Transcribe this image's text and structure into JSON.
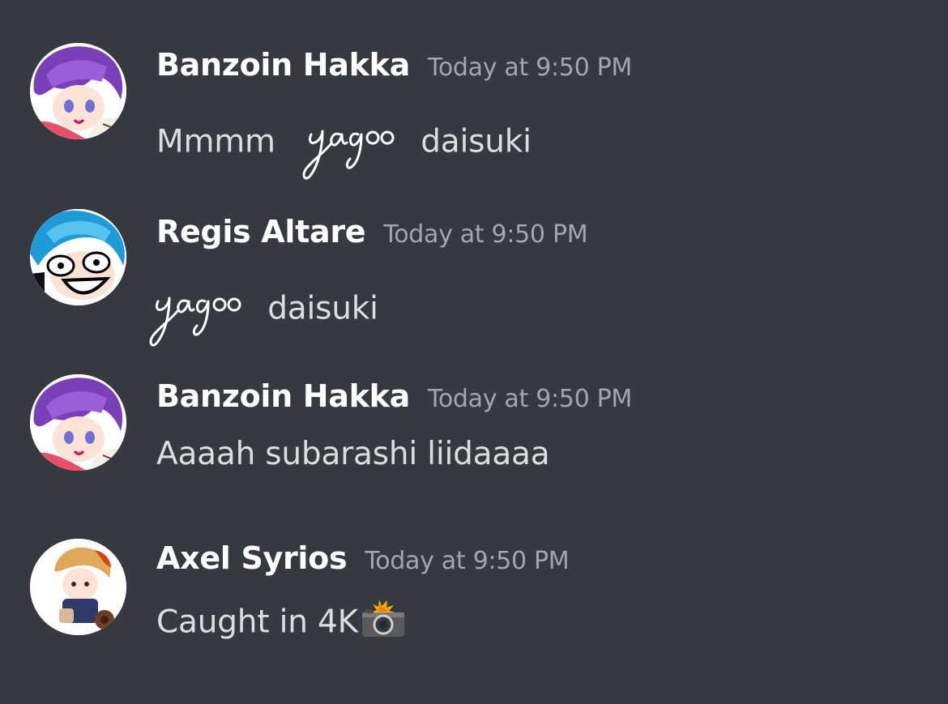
{
  "messages": [
    {
      "username": "Banzoin Hakka",
      "timestamp": "Today at 9:50 PM",
      "text_before": "Mmmm",
      "emote": "yagoo",
      "text_after": "daisuki",
      "avatar_icon": "banzoin-hakka-avatar"
    },
    {
      "username": "Regis Altare",
      "timestamp": "Today at 9:50 PM",
      "emote": "yagoo",
      "text_after": "daisuki",
      "avatar_icon": "regis-altare-avatar"
    },
    {
      "username": "Banzoin Hakka",
      "timestamp": "Today at 9:50 PM",
      "text": "Aaaah subarashi liidaaaa",
      "avatar_icon": "banzoin-hakka-avatar"
    },
    {
      "username": "Axel Syrios",
      "timestamp": "Today at 9:50 PM",
      "text": "Caught in 4K",
      "emoji": "camera-flash-icon",
      "avatar_icon": "axel-syrios-avatar"
    }
  ],
  "colors": {
    "background": "#36393f",
    "username": "#ffffff",
    "timestamp": "#a3a6aa",
    "message_text": "#dcddde"
  }
}
